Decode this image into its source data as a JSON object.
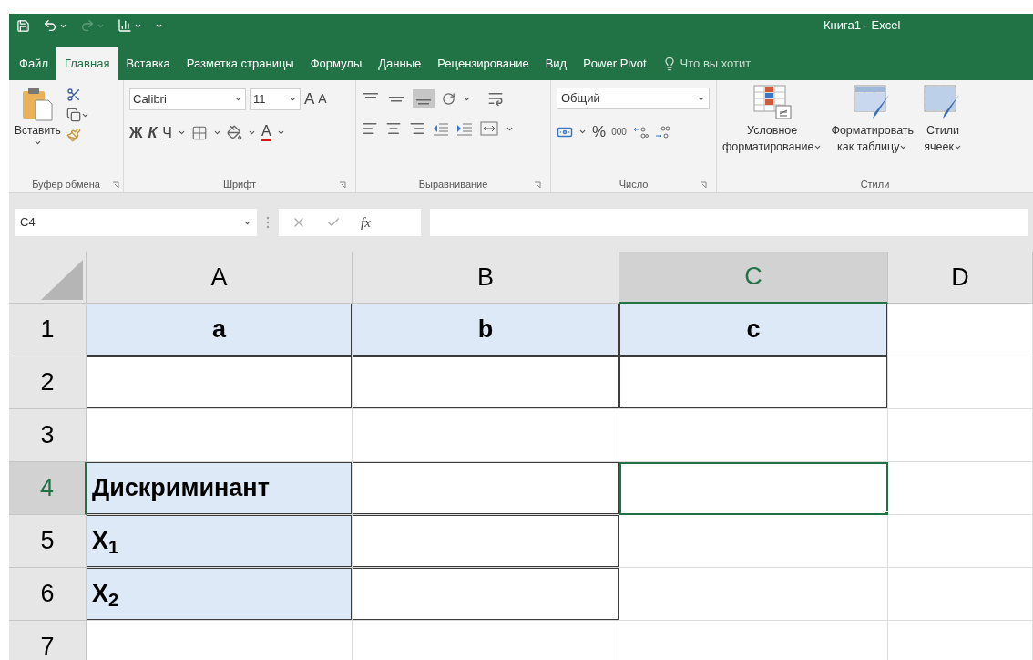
{
  "title_bar": {
    "title": "Книга1 - Excel"
  },
  "ribbon_tabs": [
    {
      "label": "Файл",
      "selected": false
    },
    {
      "label": "Главная",
      "selected": true
    },
    {
      "label": "Вставка",
      "selected": false
    },
    {
      "label": "Разметка страницы",
      "selected": false
    },
    {
      "label": "Формулы",
      "selected": false
    },
    {
      "label": "Данные",
      "selected": false
    },
    {
      "label": "Рецензирование",
      "selected": false
    },
    {
      "label": "Вид",
      "selected": false
    },
    {
      "label": "Power Pivot",
      "selected": false
    }
  ],
  "tell_me": {
    "text": "Что вы хотит"
  },
  "ribbon": {
    "clipboard": {
      "paste_label": "Вставить",
      "group_label": "Буфер обмена"
    },
    "font": {
      "font_name": "Calibri",
      "font_size": "11",
      "grow_label": "A",
      "shrink_label": "A",
      "bold_label": "Ж",
      "italic_label": "К",
      "underline_label": "Ч",
      "font_color_label": "A",
      "group_label": "Шрифт"
    },
    "alignment": {
      "group_label": "Выравнивание"
    },
    "number": {
      "format": "Общий",
      "percent_label": "%",
      "thousands_label": "000",
      "group_label": "Число"
    },
    "styles": {
      "buttons": [
        {
          "lines": [
            "Условное",
            "форматирование"
          ]
        },
        {
          "lines": [
            "Форматировать",
            "как таблицу"
          ]
        },
        {
          "lines": [
            "Стили",
            "ячеек"
          ]
        }
      ],
      "group_label": "Стили"
    }
  },
  "formula_bar": {
    "name_box": "C4",
    "function_label": "fx"
  },
  "sheet": {
    "columns": [
      {
        "label": "A",
        "selected": false
      },
      {
        "label": "B",
        "selected": false
      },
      {
        "label": "C",
        "selected": true
      },
      {
        "label": "D",
        "selected": false
      }
    ],
    "rows": [
      {
        "label": "1",
        "selected": false,
        "cells": [
          {
            "text": "a",
            "centered": true,
            "highlighted": true,
            "bordered": true,
            "selected": false
          },
          {
            "text": "b",
            "centered": true,
            "highlighted": true,
            "bordered": true,
            "selected": false
          },
          {
            "text": "c",
            "centered": true,
            "highlighted": true,
            "bordered": true,
            "selected": false
          },
          {
            "highlighted": false,
            "bordered": false,
            "selected": false
          }
        ]
      },
      {
        "label": "2",
        "selected": false,
        "cells": [
          {
            "highlighted": false,
            "bordered": true,
            "selected": false
          },
          {
            "highlighted": false,
            "bordered": true,
            "selected": false
          },
          {
            "highlighted": false,
            "bordered": true,
            "selected": false
          },
          {
            "highlighted": false,
            "bordered": false,
            "selected": false
          }
        ]
      },
      {
        "label": "3",
        "selected": false,
        "cells": [
          {
            "highlighted": false,
            "bordered": false,
            "selected": false
          },
          {
            "highlighted": false,
            "bordered": false,
            "selected": false
          },
          {
            "highlighted": false,
            "bordered": false,
            "selected": false
          },
          {
            "highlighted": false,
            "bordered": false,
            "selected": false
          }
        ]
      },
      {
        "label": "4",
        "selected": true,
        "cells": [
          {
            "text": "Дискриминант",
            "centered": false,
            "highlighted": true,
            "bordered": true,
            "selected": false
          },
          {
            "highlighted": false,
            "bordered": true,
            "selected": false
          },
          {
            "highlighted": false,
            "bordered": false,
            "selected": true
          },
          {
            "highlighted": false,
            "bordered": false,
            "selected": false
          }
        ]
      },
      {
        "label": "5",
        "selected": false,
        "cells": [
          {
            "text": "X$_{1}$",
            "centered": false,
            "highlighted": true,
            "bordered": true,
            "selected": false
          },
          {
            "highlighted": false,
            "bordered": true,
            "selected": false
          },
          {
            "highlighted": false,
            "bordered": false,
            "selected": false
          },
          {
            "highlighted": false,
            "bordered": false,
            "selected": false
          }
        ]
      },
      {
        "label": "6",
        "selected": false,
        "cells": [
          {
            "text": "X$_{2}$",
            "centered": false,
            "highlighted": true,
            "bordered": true,
            "selected": false
          },
          {
            "highlighted": false,
            "bordered": true,
            "selected": false
          },
          {
            "highlighted": false,
            "bordered": false,
            "selected": false
          },
          {
            "highlighted": false,
            "bordered": false,
            "selected": false
          }
        ]
      },
      {
        "label": "7",
        "selected": false,
        "cells": [
          {
            "highlighted": false,
            "bordered": false,
            "selected": false
          },
          {
            "highlighted": false,
            "bordered": false,
            "selected": false
          },
          {
            "highlighted": false,
            "bordered": false,
            "selected": false
          },
          {
            "highlighted": false,
            "bordered": false,
            "selected": false
          }
        ]
      }
    ]
  }
}
